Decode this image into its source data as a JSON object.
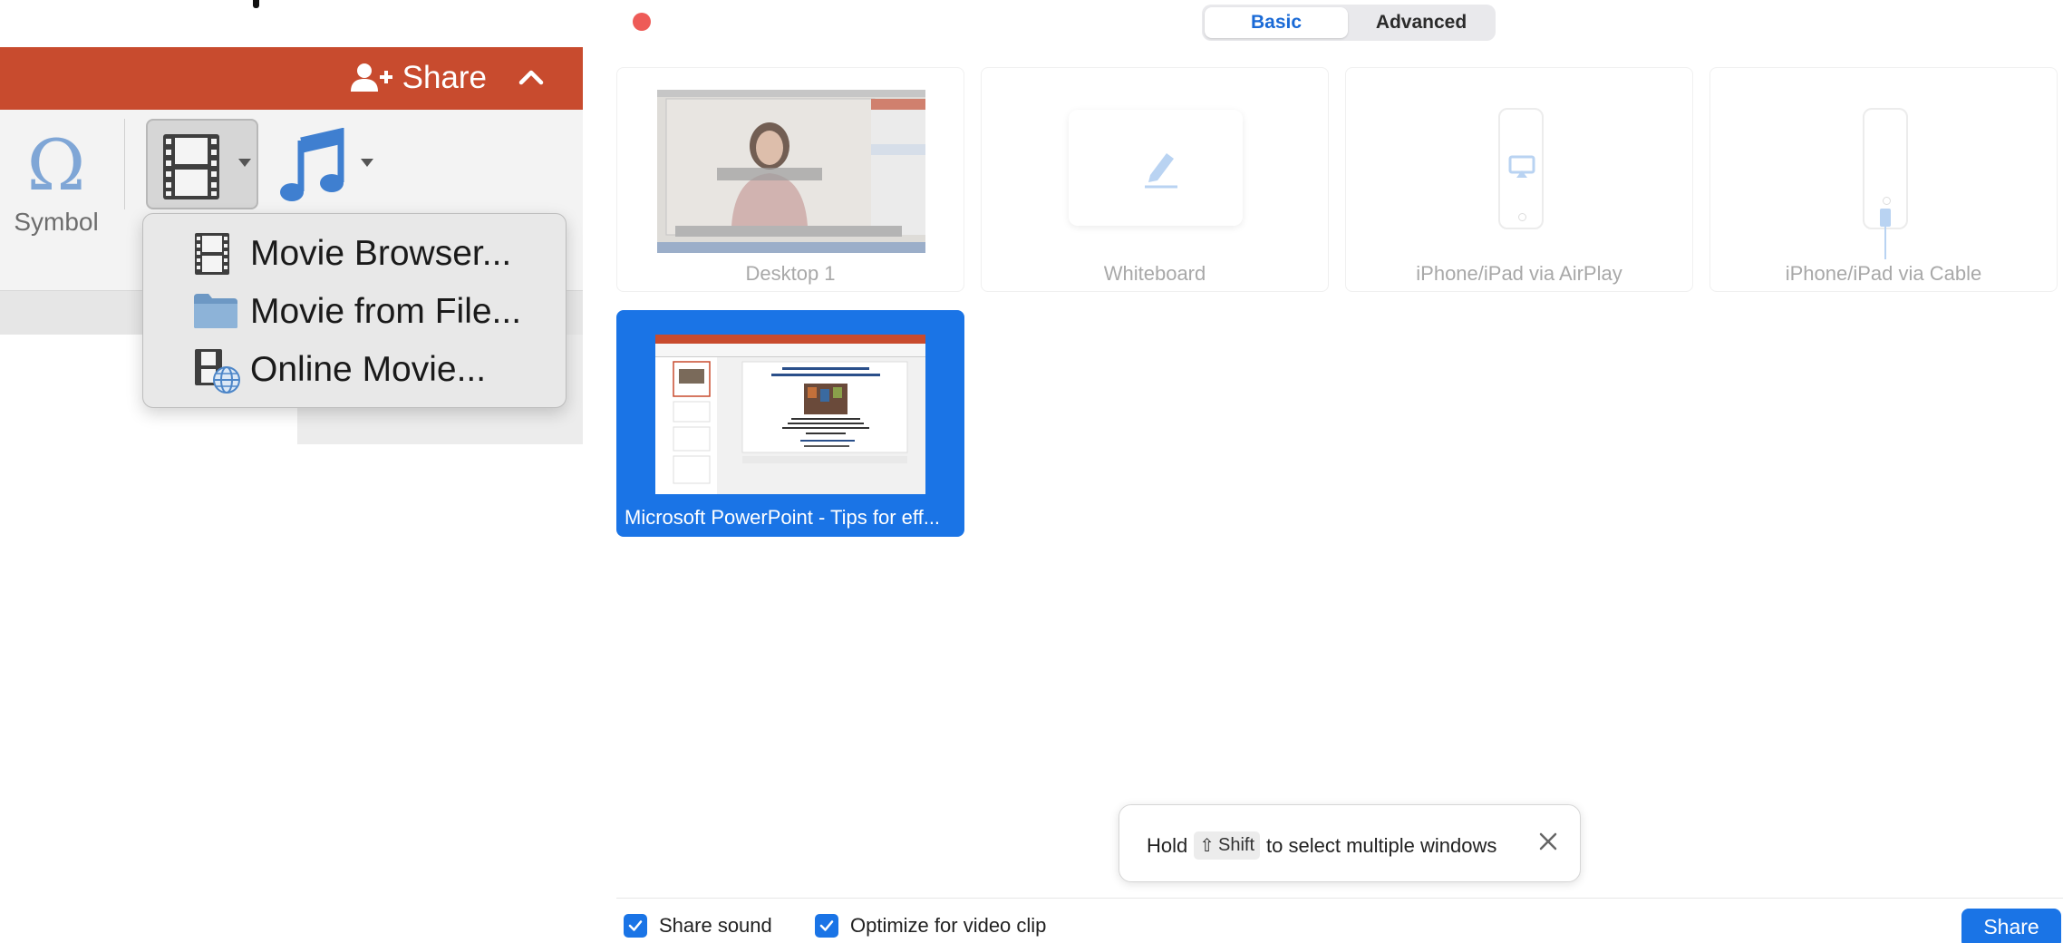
{
  "powerpoint": {
    "share_label": "Share",
    "symbol_label": "Symbol",
    "symbol_glyph": "Ω",
    "movie_menu": [
      {
        "label": "Movie Browser...",
        "icon": "film-strip-icon"
      },
      {
        "label": "Movie from File...",
        "icon": "folder-icon"
      },
      {
        "label": "Online Movie...",
        "icon": "online-movie-icon"
      }
    ],
    "titlebar_color": "#c84b2e"
  },
  "share_dialog": {
    "tabs": [
      {
        "label": "Basic",
        "selected": true
      },
      {
        "label": "Advanced",
        "selected": false
      }
    ],
    "sources": [
      {
        "label": "Desktop 1",
        "selected": false
      },
      {
        "label": "Whiteboard",
        "selected": false
      },
      {
        "label": "iPhone/iPad via AirPlay",
        "selected": false
      },
      {
        "label": "iPhone/iPad via Cable",
        "selected": false
      },
      {
        "label": "Microsoft PowerPoint - Tips for eff...",
        "selected": true
      }
    ],
    "tip": {
      "prefix": "Hold",
      "key_symbol": "⇧",
      "key_label": "Shift",
      "suffix": "to select multiple windows"
    },
    "options": [
      {
        "label": "Share sound",
        "checked": true
      },
      {
        "label": "Optimize for video clip",
        "checked": true
      }
    ],
    "share_button": "Share",
    "accent_color": "#1a74e6",
    "close_dot_color": "#ee5b57"
  }
}
